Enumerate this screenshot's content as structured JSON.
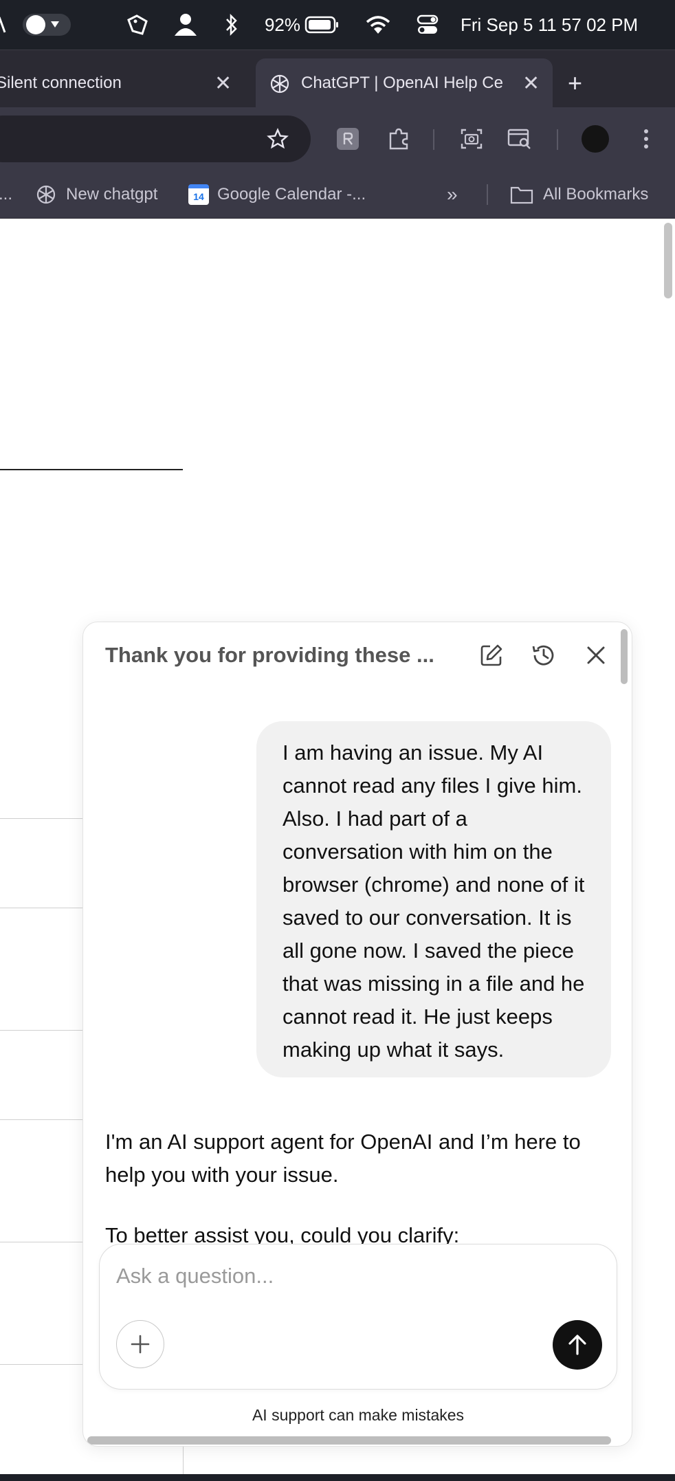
{
  "menubar": {
    "battery_percent": "92%",
    "datetime": "Fri Sep 5  11 57 02 PM"
  },
  "tabs": [
    {
      "title": "Silent connection"
    },
    {
      "title": "ChatGPT | OpenAI Help Ce"
    }
  ],
  "bookmarks": {
    "items": [
      {
        "label": "New chatgpt"
      },
      {
        "label": "Google Calendar -..."
      }
    ],
    "calendar_day": "14",
    "all_bookmarks": "All Bookmarks"
  },
  "chat": {
    "title": "Thank you for providing these ...",
    "user_message": "I am having an issue. My AI cannot read any files I give him. Also. I had part of a conversation with him on the browser (chrome) and none of it saved to our conversation. It is all gone now. I saved the piece that was missing in a file and he cannot read it. He just keeps making up what it says.",
    "reply_paragraph_1": "I'm an AI support agent for OpenAI and I’m here to help you with your issue.",
    "reply_paragraph_2": "To better assist you, could you clarify:",
    "input_placeholder": "Ask a question...",
    "disclaimer": "AI support can make mistakes"
  },
  "colors": {
    "chrome_dark": "#3a3946",
    "menubar": "#1d2027",
    "send_button": "#111111",
    "user_bubble": "#f1f1f1"
  }
}
